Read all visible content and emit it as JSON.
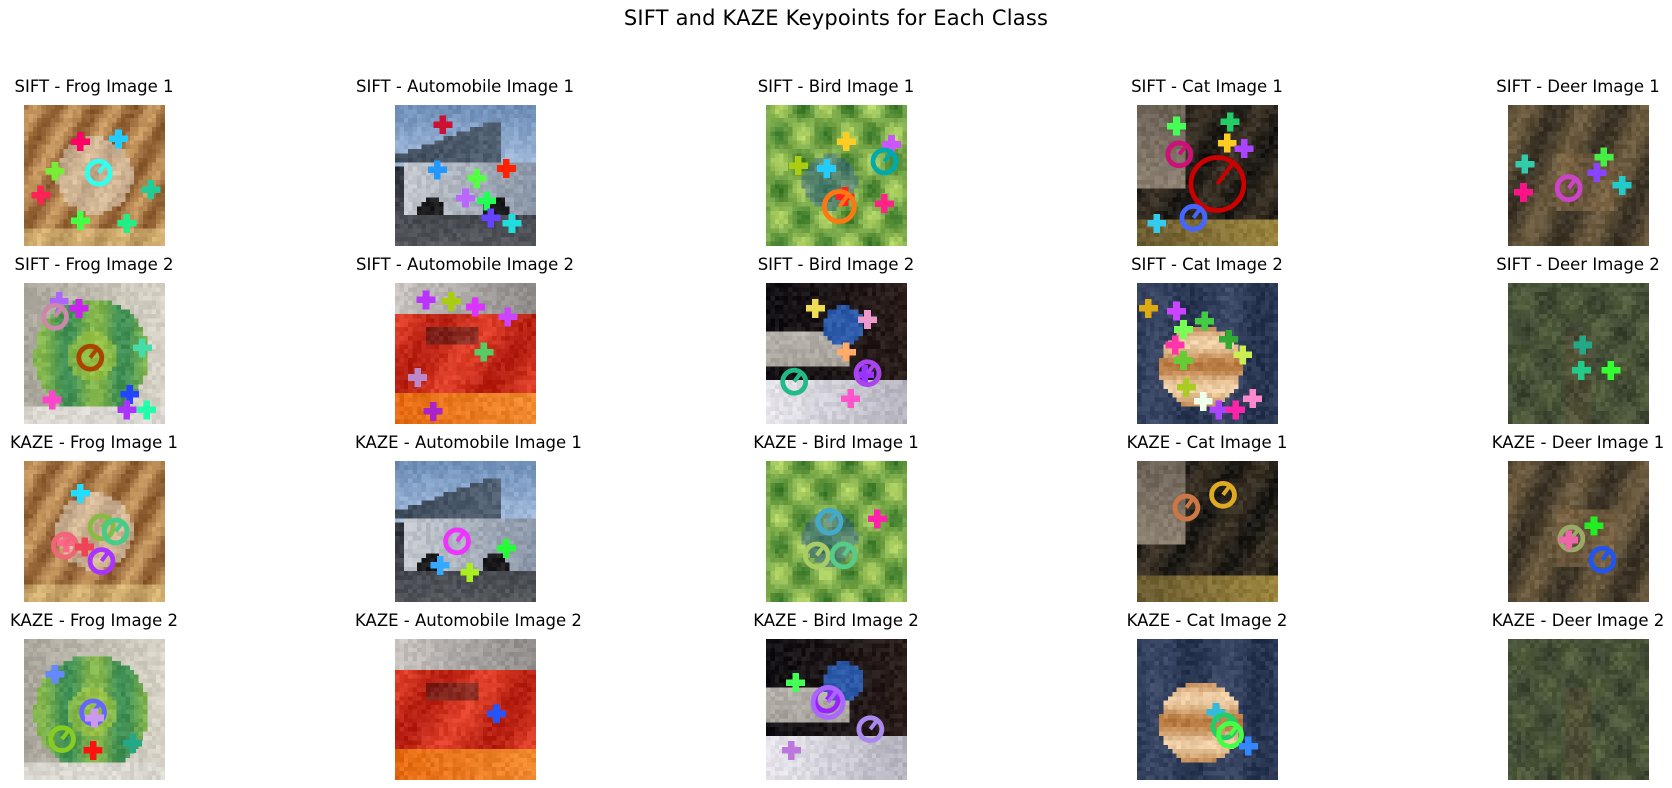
{
  "title": "SIFT and KAZE Keypoints for Each Class",
  "panels": [
    {
      "label": "SIFT - Frog Image 1",
      "cls": "frog",
      "v": 1,
      "kp": [
        [
          "#ff0066",
          0.4,
          0.26,
          1
        ],
        [
          "#22ccff",
          0.67,
          0.24,
          1
        ],
        [
          "#77ee33",
          0.22,
          0.47,
          1
        ],
        [
          "#33ffee",
          0.53,
          0.48,
          2
        ],
        [
          "#ff2255",
          0.12,
          0.64,
          1
        ],
        [
          "#22cc99",
          0.9,
          0.6,
          1
        ],
        [
          "#44ff44",
          0.4,
          0.82,
          1
        ],
        [
          "#22ee88",
          0.73,
          0.84,
          1
        ]
      ]
    },
    {
      "label": "SIFT - Automobile Image 1",
      "cls": "auto",
      "v": 1,
      "kp": [
        [
          "#cc1133",
          0.34,
          0.14,
          1
        ],
        [
          "#ff2200",
          0.79,
          0.45,
          1
        ],
        [
          "#2299ff",
          0.3,
          0.46,
          1
        ],
        [
          "#55ff44",
          0.58,
          0.52,
          1
        ],
        [
          "#bb66ff",
          0.5,
          0.66,
          1
        ],
        [
          "#22ff55",
          0.65,
          0.68,
          1
        ],
        [
          "#6644ff",
          0.68,
          0.8,
          1
        ],
        [
          "#22dddd",
          0.83,
          0.84,
          1
        ]
      ]
    },
    {
      "label": "SIFT - Bird Image 1",
      "cls": "bird",
      "v": 1,
      "kp": [
        [
          "#ffcc22",
          0.57,
          0.26,
          1
        ],
        [
          "#cc55ff",
          0.89,
          0.28,
          1
        ],
        [
          "#22ccff",
          0.43,
          0.45,
          1
        ],
        [
          "#aacc11",
          0.23,
          0.43,
          1
        ],
        [
          "#00aaaa",
          0.84,
          0.4,
          2
        ],
        [
          "#ff2222",
          0.56,
          0.65,
          1
        ],
        [
          "#ff7711",
          0.52,
          0.72,
          3
        ],
        [
          "#ff2288",
          0.84,
          0.7,
          1
        ]
      ]
    },
    {
      "label": "SIFT - Cat Image 1",
      "cls": "cat",
      "v": 1,
      "kp": [
        [
          "#44ff55",
          0.28,
          0.15,
          1
        ],
        [
          "#22cc66",
          0.66,
          0.12,
          1
        ],
        [
          "#ffcc22",
          0.64,
          0.27,
          1
        ],
        [
          "#cc1177",
          0.3,
          0.35,
          2
        ],
        [
          "#cc0000",
          0.57,
          0.56,
          4
        ],
        [
          "#aa44ff",
          0.76,
          0.31,
          1
        ],
        [
          "#4466ff",
          0.4,
          0.8,
          2
        ],
        [
          "#33ccee",
          0.14,
          0.84,
          1
        ]
      ]
    },
    {
      "label": "SIFT - Deer Image 1",
      "cls": "deer",
      "v": 1,
      "kp": [
        [
          "#33ccaa",
          0.12,
          0.42,
          1
        ],
        [
          "#44ee44",
          0.68,
          0.37,
          1
        ],
        [
          "#8844ff",
          0.63,
          0.48,
          1
        ],
        [
          "#cc44cc",
          0.43,
          0.59,
          2
        ],
        [
          "#ff1188",
          0.11,
          0.62,
          1
        ],
        [
          "#22cccc",
          0.81,
          0.57,
          1
        ]
      ]
    },
    {
      "label": "SIFT - Frog Image 2",
      "cls": "frog",
      "v": 2,
      "kp": [
        [
          "#aa66ff",
          0.25,
          0.13,
          1
        ],
        [
          "#cc88aa",
          0.22,
          0.24,
          2
        ],
        [
          "#cc22ee",
          0.39,
          0.18,
          1
        ],
        [
          "#aa4400",
          0.47,
          0.53,
          2
        ],
        [
          "#44ddaa",
          0.84,
          0.46,
          1
        ],
        [
          "#2244ff",
          0.75,
          0.79,
          1
        ],
        [
          "#ff44cc",
          0.2,
          0.83,
          1
        ],
        [
          "#aa33ff",
          0.73,
          0.9,
          1
        ],
        [
          "#22ffaa",
          0.87,
          0.9,
          1
        ]
      ]
    },
    {
      "label": "SIFT - Automobile Image 2",
      "cls": "auto",
      "v": 2,
      "kp": [
        [
          "#bb33ff",
          0.22,
          0.12,
          1
        ],
        [
          "#aacc11",
          0.4,
          0.13,
          1
        ],
        [
          "#dd33ff",
          0.57,
          0.17,
          1
        ],
        [
          "#cc44ff",
          0.8,
          0.24,
          1
        ],
        [
          "#55cc66",
          0.63,
          0.49,
          1
        ],
        [
          "#bb88cc",
          0.16,
          0.67,
          1
        ],
        [
          "#aa22cc",
          0.27,
          0.91,
          1
        ]
      ]
    },
    {
      "label": "SIFT - Bird Image 2",
      "cls": "bird",
      "v": 2,
      "kp": [
        [
          "#eedd55",
          0.35,
          0.18,
          1
        ],
        [
          "#ee99cc",
          0.72,
          0.26,
          1
        ],
        [
          "#ffaa66",
          0.57,
          0.49,
          1
        ],
        [
          "#22bb88",
          0.2,
          0.7,
          2
        ],
        [
          "#9933ff",
          0.7,
          0.65,
          1
        ],
        [
          "#aa44ee",
          0.72,
          0.64,
          2
        ],
        [
          "#ff55cc",
          0.6,
          0.82,
          1
        ]
      ]
    },
    {
      "label": "SIFT - Cat Image 2",
      "cls": "cat",
      "v": 2,
      "kp": [
        [
          "#ddaa11",
          0.08,
          0.18,
          1
        ],
        [
          "#cc44ff",
          0.28,
          0.2,
          1
        ],
        [
          "#77ff55",
          0.33,
          0.33,
          1
        ],
        [
          "#44cc44",
          0.48,
          0.27,
          1
        ],
        [
          "#33aa33",
          0.65,
          0.4,
          1
        ],
        [
          "#ff33aa",
          0.27,
          0.44,
          1
        ],
        [
          "#ccee55",
          0.75,
          0.51,
          1
        ],
        [
          "#66cc33",
          0.33,
          0.55,
          1
        ],
        [
          "#aacc22",
          0.35,
          0.74,
          1
        ],
        [
          "#eeffee",
          0.47,
          0.84,
          1
        ],
        [
          "#aa44ff",
          0.58,
          0.9,
          1
        ],
        [
          "#ff22aa",
          0.7,
          0.9,
          1
        ],
        [
          "#ff88cc",
          0.82,
          0.82,
          1
        ]
      ]
    },
    {
      "label": "SIFT - Deer Image 2",
      "cls": "deer",
      "v": 2,
      "kp": [
        [
          "#22aa88",
          0.53,
          0.44,
          1
        ],
        [
          "#22cc88",
          0.52,
          0.62,
          1
        ],
        [
          "#33ff33",
          0.73,
          0.62,
          1
        ]
      ]
    },
    {
      "label": "KAZE - Frog Image 1",
      "cls": "frog",
      "v": 1,
      "kp": [
        [
          "#22ddff",
          0.4,
          0.23,
          1
        ],
        [
          "#88bb44",
          0.55,
          0.47,
          2
        ],
        [
          "#44cc88",
          0.65,
          0.5,
          2
        ],
        [
          "#ff6688",
          0.3,
          0.58,
          1
        ],
        [
          "#ee6677",
          0.29,
          0.6,
          2
        ],
        [
          "#ee4455",
          0.43,
          0.61,
          1
        ],
        [
          "#aa33ff",
          0.55,
          0.71,
          2
        ]
      ]
    },
    {
      "label": "KAZE - Automobile Image 1",
      "cls": "auto",
      "v": 1,
      "kp": [
        [
          "#ee33ff",
          0.44,
          0.57,
          2
        ],
        [
          "#22ff33",
          0.79,
          0.62,
          1
        ],
        [
          "#33aaff",
          0.32,
          0.74,
          1
        ],
        [
          "#aaee22",
          0.53,
          0.79,
          1
        ]
      ]
    },
    {
      "label": "KAZE - Bird Image 1",
      "cls": "bird",
      "v": 1,
      "kp": [
        [
          "#ff22aa",
          0.79,
          0.41,
          1
        ],
        [
          "#44aacc",
          0.45,
          0.43,
          2
        ],
        [
          "#aacc66",
          0.36,
          0.67,
          2
        ],
        [
          "#55cc88",
          0.55,
          0.67,
          2
        ]
      ]
    },
    {
      "label": "KAZE - Cat Image 1",
      "cls": "cat",
      "v": 1,
      "kp": [
        [
          "#ddaa22",
          0.61,
          0.24,
          2
        ],
        [
          "#cc7744",
          0.35,
          0.33,
          2
        ]
      ]
    },
    {
      "label": "KAZE - Deer Image 1",
      "cls": "deer",
      "v": 1,
      "kp": [
        [
          "#22ee22",
          0.61,
          0.46,
          1
        ],
        [
          "#99aa66",
          0.45,
          0.55,
          2
        ],
        [
          "#ee66aa",
          0.43,
          0.56,
          1
        ],
        [
          "#2255ee",
          0.67,
          0.7,
          2
        ]
      ]
    },
    {
      "label": "KAZE - Frog Image 2",
      "cls": "frog",
      "v": 2,
      "kp": [
        [
          "#6688ff",
          0.22,
          0.25,
          1
        ],
        [
          "#6666ff",
          0.49,
          0.52,
          2
        ],
        [
          "#cc99ee",
          0.5,
          0.56,
          1
        ],
        [
          "#88cc22",
          0.27,
          0.71,
          2
        ],
        [
          "#ff1111",
          0.49,
          0.79,
          1
        ],
        [
          "#22aa88",
          0.77,
          0.74,
          1
        ]
      ]
    },
    {
      "label": "KAZE - Automobile Image 2",
      "cls": "auto",
      "v": 2,
      "kp": [
        [
          "#2255ff",
          0.72,
          0.53,
          1
        ]
      ]
    },
    {
      "label": "KAZE - Bird Image 2",
      "cls": "bird",
      "v": 2,
      "kp": [
        [
          "#44ff55",
          0.21,
          0.31,
          1
        ],
        [
          "#9922ff",
          0.43,
          0.43,
          2
        ],
        [
          "#aa66ff",
          0.44,
          0.45,
          3
        ],
        [
          "#aa88ee",
          0.74,
          0.64,
          2
        ],
        [
          "#bb77dd",
          0.18,
          0.79,
          1
        ]
      ]
    },
    {
      "label": "KAZE - Cat Image 2",
      "cls": "cat",
      "v": 2,
      "kp": [
        [
          "#33bbdd",
          0.56,
          0.52,
          1
        ],
        [
          "#22cc66",
          0.62,
          0.62,
          2
        ],
        [
          "#44ff44",
          0.66,
          0.68,
          2
        ],
        [
          "#3388ff",
          0.79,
          0.76,
          1
        ]
      ]
    },
    {
      "label": "KAZE - Deer Image 2",
      "cls": "deer",
      "v": 2,
      "kp": []
    }
  ]
}
